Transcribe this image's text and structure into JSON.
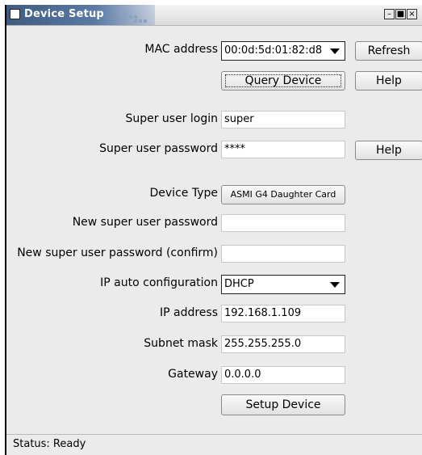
{
  "window": {
    "title": "Device Setup",
    "controls": [
      "minimize-icon",
      "maximize-icon",
      "close-icon"
    ]
  },
  "mac": {
    "label": "MAC address",
    "value": "00:0d:5d:01:82:d8"
  },
  "buttons": {
    "refresh": "Refresh",
    "query": "Query Device",
    "help1": "Help",
    "help2": "Help",
    "setup": "Setup Device"
  },
  "super_login": {
    "label": "Super user login",
    "value": "super"
  },
  "super_password": {
    "label": "Super user password",
    "value": "****"
  },
  "device_type": {
    "label": "Device Type",
    "value": "ASMI G4 Daughter Card"
  },
  "new_password": {
    "label": "New super user password",
    "value": ""
  },
  "new_password_confirm": {
    "label": "New super user password (confirm)",
    "value": ""
  },
  "ip_auto": {
    "label": "IP auto configuration",
    "value": "DHCP"
  },
  "ip_address": {
    "label": "IP address",
    "value": "192.168.1.109"
  },
  "subnet": {
    "label": "Subnet mask",
    "value": "255.255.255.0"
  },
  "gateway": {
    "label": "Gateway",
    "value": "0.0.0.0"
  },
  "status": {
    "text": "Status: Ready"
  }
}
